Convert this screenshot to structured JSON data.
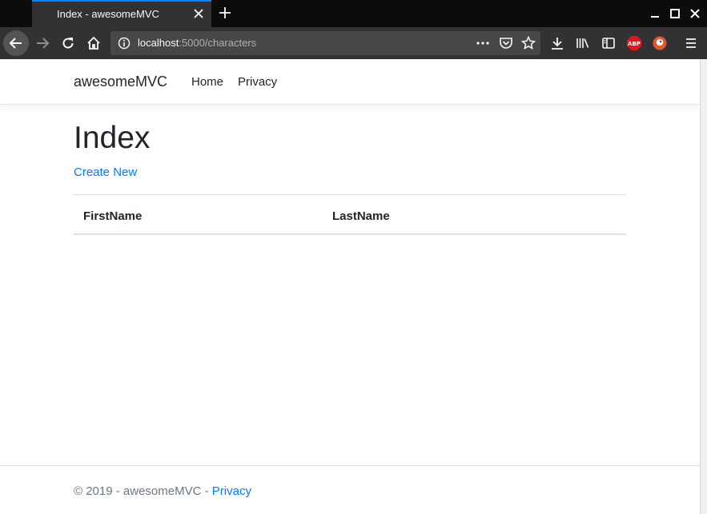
{
  "browser": {
    "tab_title": "Index - awesomeMVC",
    "url_host": "localhost",
    "url_path": ":5000/characters",
    "accent_color": "#0a84ff"
  },
  "navbar": {
    "brand": "awesomeMVC",
    "links": [
      "Home",
      "Privacy"
    ]
  },
  "main": {
    "title": "Index",
    "create_link": "Create New",
    "table": {
      "columns": [
        "FirstName",
        "LastName"
      ],
      "rows": []
    }
  },
  "footer": {
    "text": "© 2019 - awesomeMVC - ",
    "link": "Privacy"
  },
  "icons": [
    "close-icon",
    "plus-icon",
    "minimize-icon",
    "maximize-icon",
    "window-close-icon",
    "back-arrow-icon",
    "forward-arrow-icon",
    "reload-icon",
    "home-icon",
    "info-icon",
    "more-icon",
    "pocket-icon",
    "bookmark-star-icon",
    "download-icon",
    "library-icon",
    "sidebar-icon",
    "adblock-icon",
    "duckduckgo-icon",
    "menu-icon"
  ]
}
